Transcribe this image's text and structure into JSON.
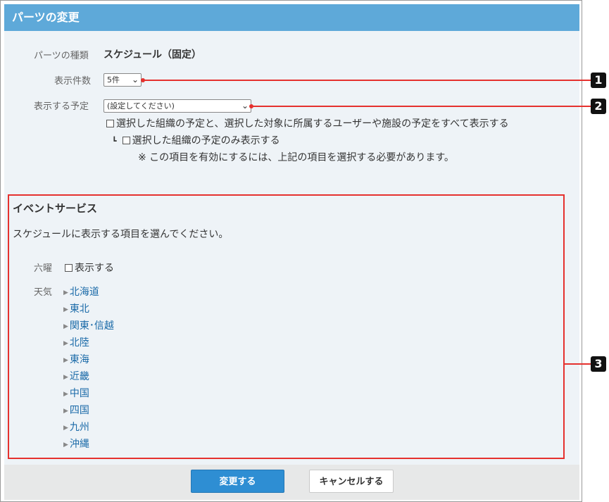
{
  "header": {
    "title": "パーツの変更"
  },
  "form": {
    "parts_type_label": "パーツの種類",
    "parts_type_value": "スケジュール（固定）",
    "count_label": "表示件数",
    "count_value": "5件",
    "schedule_label": "表示する予定",
    "schedule_value": "(設定してください)",
    "option1": "選択した組織の予定と、選択した対象に所属するユーザーや施設の予定をすべて表示する",
    "option2_prefix": "┗",
    "option2": "選択した組織の予定のみ表示する",
    "note": "※ この項目を有効にするには、上記の項目を選択する必要があります。"
  },
  "event": {
    "title": "イベントサービス",
    "description": "スケジュールに表示する項目を選んでください。",
    "rokuyo_label": "六曜",
    "rokuyo_option": "表示する",
    "weather_label": "天気",
    "regions": [
      "北海道",
      "東北",
      "関東･信越",
      "北陸",
      "東海",
      "近畿",
      "中国",
      "四国",
      "九州",
      "沖縄"
    ]
  },
  "footer": {
    "save_label": "変更する",
    "cancel_label": "キャンセルする"
  },
  "callouts": [
    "1",
    "2",
    "3"
  ],
  "colors": {
    "header": "#5ea9d9",
    "panel": "#eef3f7",
    "highlight": "#e5312e",
    "primary_button": "#2e8ed3",
    "link": "#1a6aa8"
  }
}
